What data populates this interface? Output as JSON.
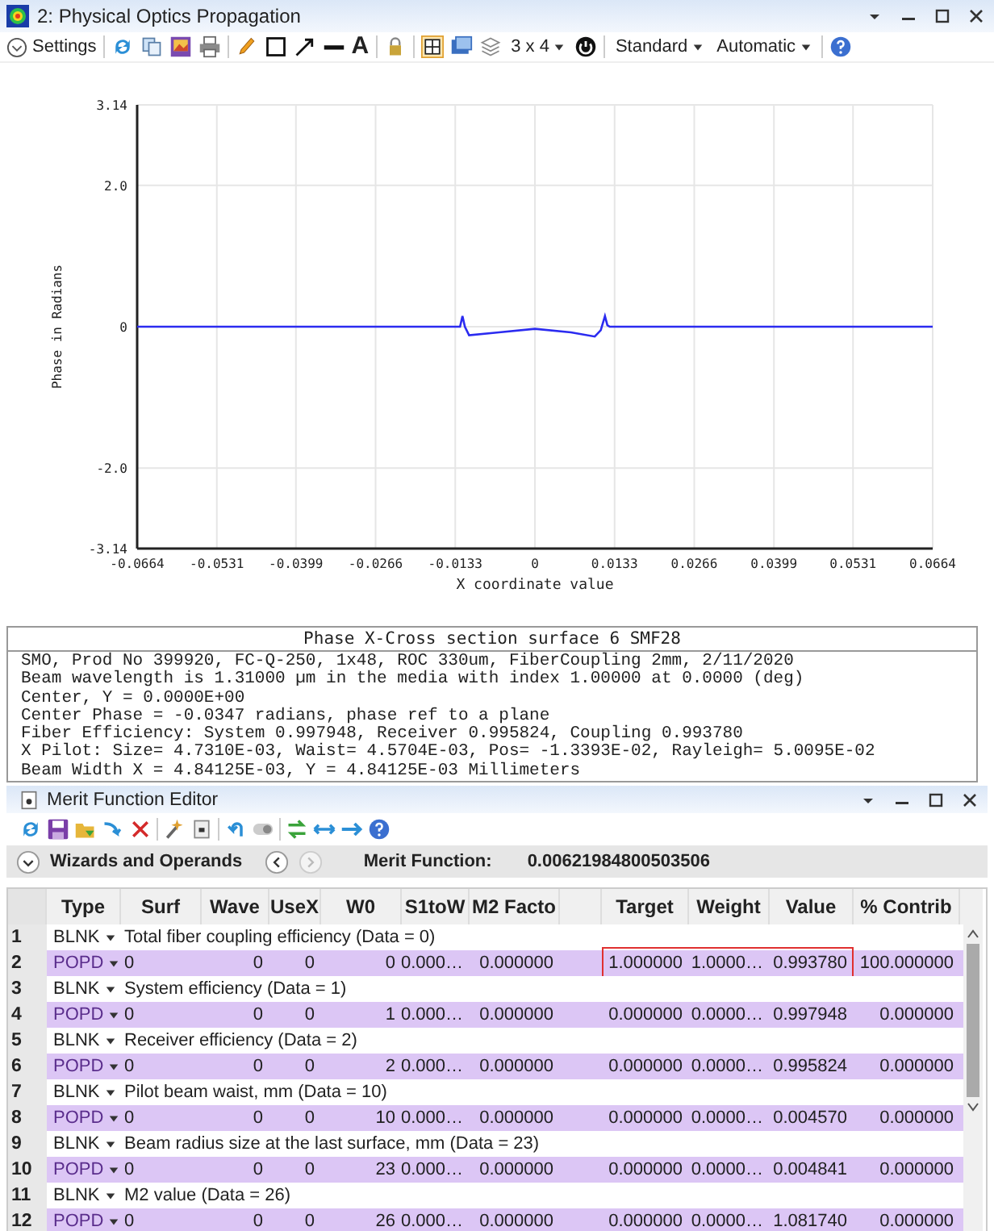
{
  "window": {
    "title": "2: Physical Optics Propagation"
  },
  "toolbar": {
    "settings_label": "Settings",
    "text_tool": "A",
    "grid_toggle_on": true,
    "layout_label": "3 x 4",
    "style_label": "Standard",
    "scale_label": "Automatic"
  },
  "chart_data": {
    "type": "line",
    "xlabel": "X coordinate value",
    "ylabel": "Phase in Radians",
    "x": [
      -0.0664,
      -0.0125,
      -0.0121,
      -0.0117,
      -0.011,
      -0.006,
      0,
      0.006,
      0.01,
      0.011,
      0.0117,
      0.0121,
      0.0125,
      0.0664
    ],
    "grid": true,
    "series": [
      {
        "color": "#2b2bf0",
        "values": [
          0,
          0,
          0.15,
          0,
          -0.12,
          -0.08,
          -0.03,
          -0.08,
          -0.14,
          -0.05,
          0.15,
          0.02,
          0,
          0
        ]
      }
    ],
    "xlim": [
      -0.0664,
      0.0664
    ],
    "ylim": [
      -3.14,
      3.14
    ],
    "xticks": [
      -0.0664,
      -0.0531,
      -0.0399,
      -0.0266,
      -0.0133,
      0,
      0.0133,
      0.0266,
      0.0399,
      0.0531,
      0.0664
    ],
    "yticks": [
      {
        "value": -3.14,
        "label": "-3.14"
      },
      {
        "value": -2,
        "label": "-2.0"
      },
      {
        "value": 0,
        "label": "0"
      },
      {
        "value": 2,
        "label": "2.0"
      },
      {
        "value": 3.14,
        "label": "3.14"
      }
    ]
  },
  "text_panel": {
    "title": "Phase X-Cross section surface 6 SMF28",
    "lines": [
      "SMO, Prod No 399920, FC-Q-250, 1x48, ROC 330um, FiberCoupling 2mm, 2/11/2020",
      "Beam wavelength is 1.31000 µm in the media with index 1.00000 at 0.0000 (deg)",
      "Center, Y = 0.0000E+00",
      "Center Phase = -0.0347 radians, phase ref to a plane",
      "Fiber Efficiency: System 0.997948, Receiver 0.995824, Coupling 0.993780",
      "X Pilot: Size= 4.7310E-03, Waist= 4.5704E-03, Pos= -1.3393E-02, Rayleigh= 5.0095E-02",
      "Beam Width X = 4.84125E-03, Y = 4.84125E-03 Millimeters"
    ]
  },
  "merit_editor": {
    "title": "Merit Function Editor",
    "wizards_label": "Wizards and Operands",
    "back_disabled": false,
    "forward_disabled": true,
    "merit_label": "Merit Function:",
    "merit_value": "0.00621984800503506",
    "columns": [
      "Type",
      "Surf",
      "Wave",
      "UseX",
      "W0",
      "S1toW",
      "M2 Facto",
      "",
      "Target",
      "Weight",
      "Value",
      "% Contrib"
    ],
    "rows": [
      {
        "num": "1",
        "kind": "blank",
        "type": "BLNK",
        "comment": "Total fiber coupling efficiency (Data = 0)"
      },
      {
        "num": "2",
        "kind": "operand",
        "type": "POPD",
        "highlighted": true,
        "cells": [
          "0",
          "0",
          "0",
          "0",
          "0.000…",
          "0.000000",
          "1.000000",
          "1.0000…",
          "0.993780",
          "100.000000"
        ]
      },
      {
        "num": "3",
        "kind": "blank",
        "type": "BLNK",
        "comment": "System efficiency (Data = 1)"
      },
      {
        "num": "4",
        "kind": "operand",
        "type": "POPD",
        "highlighted": false,
        "cells": [
          "0",
          "0",
          "0",
          "1",
          "0.000…",
          "0.000000",
          "0.000000",
          "0.0000…",
          "0.997948",
          "0.000000"
        ]
      },
      {
        "num": "5",
        "kind": "blank",
        "type": "BLNK",
        "comment": "Receiver efficiency (Data = 2)"
      },
      {
        "num": "6",
        "kind": "operand",
        "type": "POPD",
        "highlighted": false,
        "cells": [
          "0",
          "0",
          "0",
          "2",
          "0.000…",
          "0.000000",
          "0.000000",
          "0.0000…",
          "0.995824",
          "0.000000"
        ]
      },
      {
        "num": "7",
        "kind": "blank",
        "type": "BLNK",
        "comment": "Pilot beam waist, mm (Data = 10)"
      },
      {
        "num": "8",
        "kind": "operand",
        "type": "POPD",
        "highlighted": false,
        "cells": [
          "0",
          "0",
          "0",
          "10",
          "0.000…",
          "0.000000",
          "0.000000",
          "0.0000…",
          "0.004570",
          "0.000000"
        ]
      },
      {
        "num": "9",
        "kind": "blank",
        "type": "BLNK",
        "comment": "Beam radius size at the last surface, mm (Data = 23)"
      },
      {
        "num": "10",
        "kind": "operand",
        "type": "POPD",
        "highlighted": false,
        "cells": [
          "0",
          "0",
          "0",
          "23",
          "0.000…",
          "0.000000",
          "0.000000",
          "0.0000…",
          "0.004841",
          "0.000000"
        ]
      },
      {
        "num": "11",
        "kind": "blank",
        "type": "BLNK",
        "comment": "M2 value (Data = 26)"
      },
      {
        "num": "12",
        "kind": "operand",
        "type": "POPD",
        "highlighted": false,
        "cells": [
          "0",
          "0",
          "0",
          "26",
          "0.000…",
          "0.000000",
          "0.000000",
          "0.0000…",
          "1.081740",
          "0.000000"
        ]
      }
    ]
  }
}
